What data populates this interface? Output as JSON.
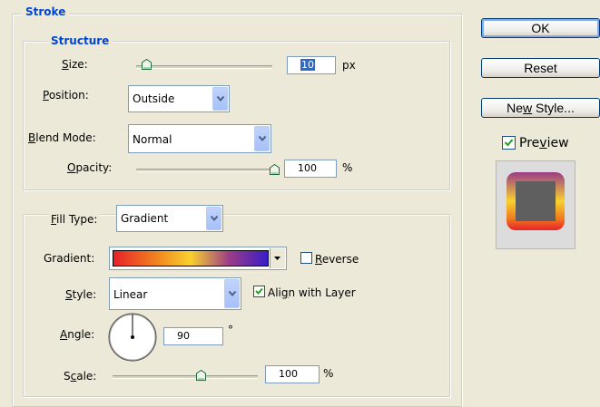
{
  "stroke": {
    "legend": "Stroke",
    "structure": {
      "legend": "Structure",
      "size": {
        "label_u": "S",
        "label_rest": "ize:",
        "value": "10",
        "unit": "px",
        "slider_fraction": 0.1
      },
      "position": {
        "label_u": "P",
        "label_rest": "osition:",
        "selected": "Outside"
      },
      "blend_mode": {
        "label_u": "B",
        "label_rest": "lend Mode:",
        "selected": "Normal"
      },
      "opacity": {
        "label_u": "O",
        "label_rest": "pacity:",
        "value": "100",
        "unit": "%",
        "slider_fraction": 1.0
      }
    },
    "fill": {
      "fill_type": {
        "label_u": "F",
        "label_rest": "ill Type:",
        "selected": "Gradient"
      },
      "gradient": {
        "label": "Gradient:",
        "colors": [
          "#e8202a",
          "#f07a1e",
          "#f8d12e",
          "#9b3c86",
          "#3a1cc8"
        ]
      },
      "reverse": {
        "label_u": "R",
        "label_rest": "everse",
        "checked": false
      },
      "style": {
        "label_u": "S",
        "label_rest": "tyle:",
        "selected": "Linear"
      },
      "align": {
        "label_pre": "Ali",
        "label_u": "g",
        "label_rest": "n with Layer",
        "checked": true
      },
      "angle": {
        "label_u": "A",
        "label_rest": "ngle:",
        "value": "90",
        "unit": "°"
      },
      "scale": {
        "label_pre": "S",
        "label_u": "c",
        "label_rest": "ale:",
        "value": "100",
        "unit": "%",
        "slider_fraction": 0.5
      }
    }
  },
  "buttons": {
    "ok": "OK",
    "reset": "Reset",
    "new_style_pre": "Ne",
    "new_style_u": "w",
    "new_style_rest": " Style..."
  },
  "preview": {
    "label_pre": "Pre",
    "label_u": "v",
    "label_rest": "iew",
    "checked": true
  },
  "colors": {
    "accent": "#0046d5",
    "selection": "#316ac5",
    "input_border": "#7f9db9"
  }
}
